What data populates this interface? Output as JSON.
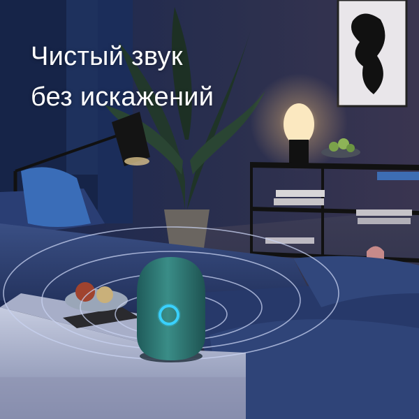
{
  "headline": {
    "line1": "Чистый звук",
    "line2": "без искажений"
  },
  "colors": {
    "text": "#ffffff",
    "speaker_body": "#2f7d79",
    "speaker_ring": "#2fc7ff",
    "lamp_glow": "#ffd98a",
    "sofa": "#2b3e6e"
  }
}
